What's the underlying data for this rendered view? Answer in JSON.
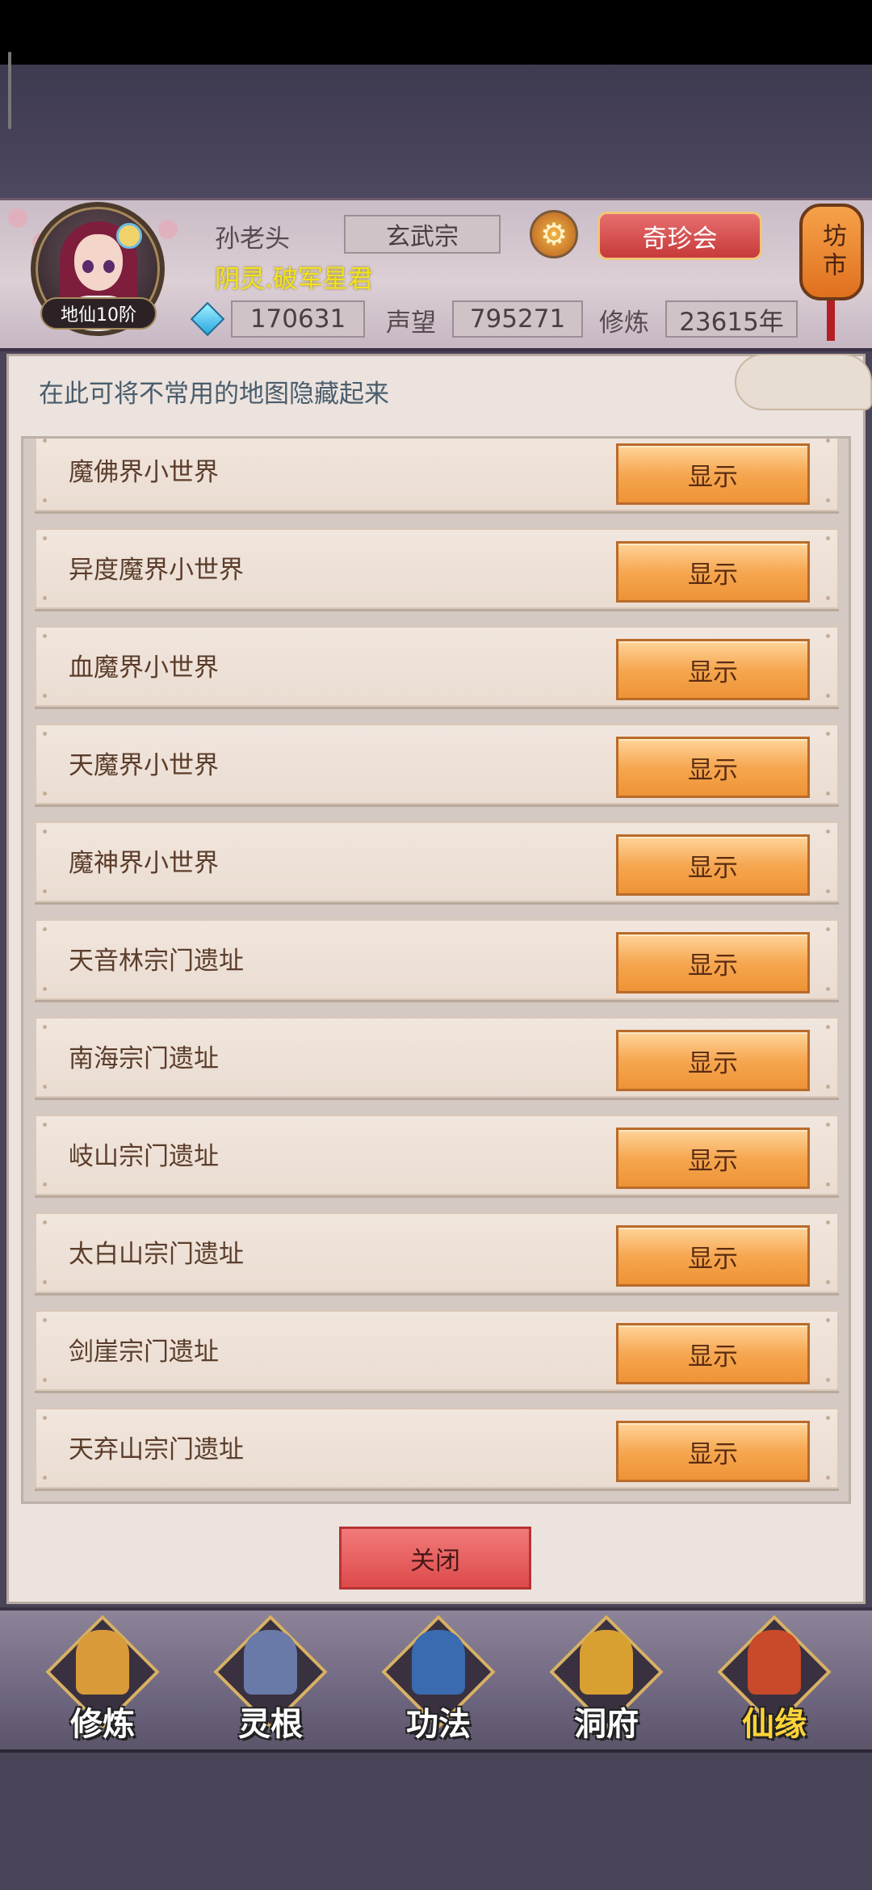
{
  "header": {
    "player_name": "孙老头",
    "sect": "玄武宗",
    "title": "阴灵.破军星君",
    "level": "地仙10阶",
    "treasure_label": "奇珍会",
    "market_label": "坊市",
    "stats": {
      "gems": "170631",
      "reputation_label": "声望",
      "reputation": "795271",
      "cultivation_label": "修炼",
      "cultivation": "23615年"
    }
  },
  "panel": {
    "hint": "在此可将不常用的地图隐藏起来",
    "rows": [
      {
        "label": "魔佛界小世界",
        "action": "显示"
      },
      {
        "label": "异度魔界小世界",
        "action": "显示"
      },
      {
        "label": "血魔界小世界",
        "action": "显示"
      },
      {
        "label": "天魔界小世界",
        "action": "显示"
      },
      {
        "label": "魔神界小世界",
        "action": "显示"
      },
      {
        "label": "天音林宗门遗址",
        "action": "显示"
      },
      {
        "label": "南海宗门遗址",
        "action": "显示"
      },
      {
        "label": "岐山宗门遗址",
        "action": "显示"
      },
      {
        "label": "太白山宗门遗址",
        "action": "显示"
      },
      {
        "label": "剑崖宗门遗址",
        "action": "显示"
      },
      {
        "label": "天弃山宗门遗址",
        "action": "显示"
      }
    ],
    "close_label": "关闭"
  },
  "nav": [
    {
      "label": "修炼",
      "icon": "cultivate-icon",
      "color": "#d99a3a"
    },
    {
      "label": "灵根",
      "icon": "spirit-root-icon",
      "color": "#6a7aa8"
    },
    {
      "label": "功法",
      "icon": "technique-book-icon",
      "color": "#3a6ab0"
    },
    {
      "label": "洞府",
      "icon": "cave-dwelling-icon",
      "color": "#d8a030"
    },
    {
      "label": "仙缘",
      "icon": "gourd-icon",
      "color": "#c84a2a"
    }
  ]
}
